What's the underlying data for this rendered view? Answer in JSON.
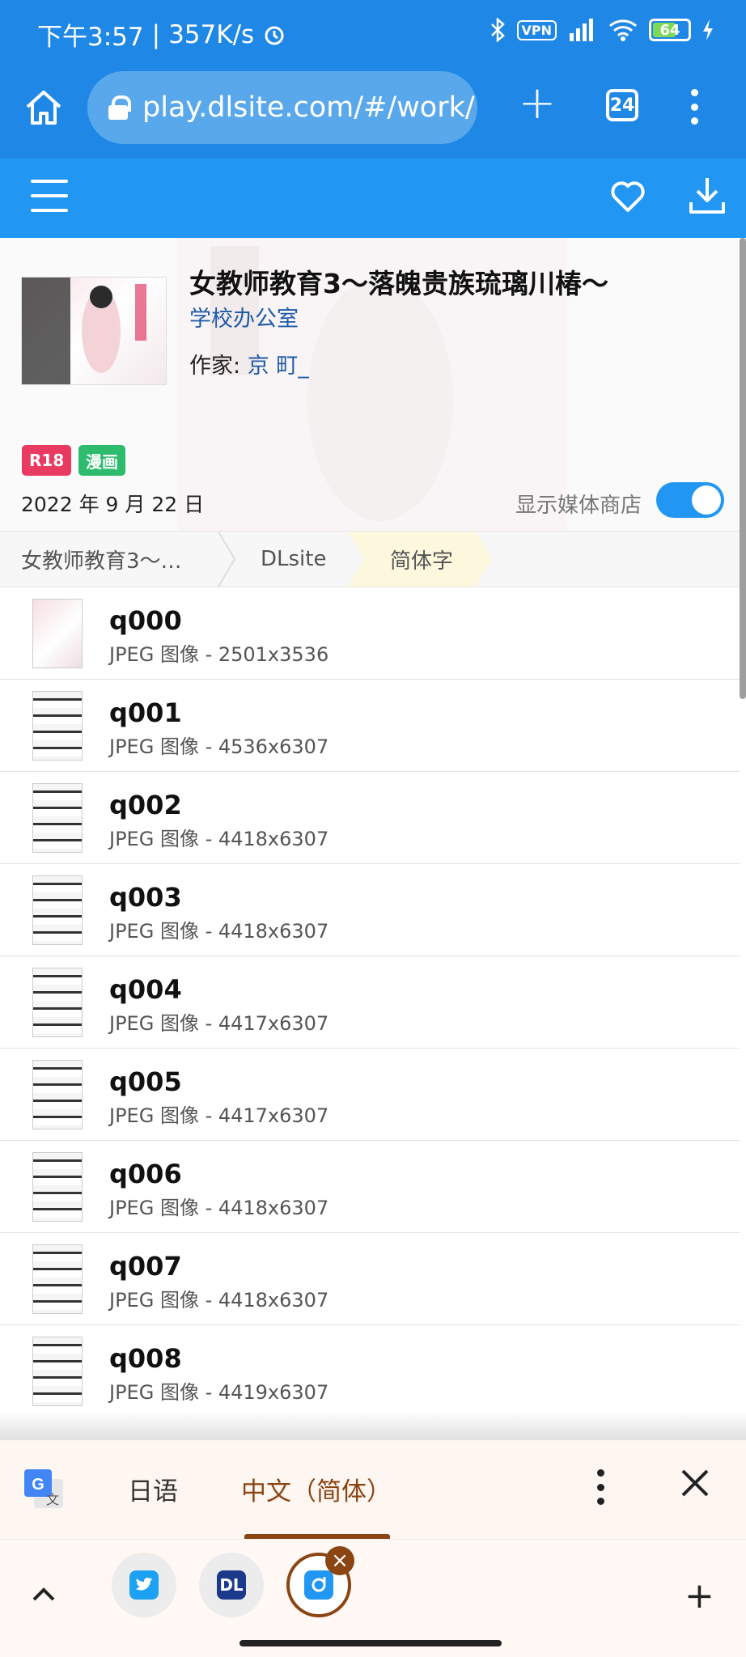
{
  "status_bar": {
    "time": "下午3:57",
    "speed": "357K/s",
    "vpn": "VPN",
    "battery": "64"
  },
  "browser": {
    "url": "play.dlsite.com/#/work/",
    "tab_count": "24"
  },
  "work": {
    "title": "女教师教育3～落魄贵族琉璃川椿～",
    "circle": "学校办公室",
    "author_label": "作家: ",
    "author": "京 町_",
    "tags": [
      "R18",
      "漫画"
    ],
    "release_date": "2022 年 9 月 22 日",
    "media_label": "显示媒体商店",
    "media_toggle": true
  },
  "breadcrumb": [
    "女教师教育3～…",
    "DLsite",
    "简体字"
  ],
  "files": [
    {
      "name": "q000",
      "desc": "JPEG 图像 - 2501x3536"
    },
    {
      "name": "q001",
      "desc": "JPEG 图像 - 4536x6307"
    },
    {
      "name": "q002",
      "desc": "JPEG 图像 - 4418x6307"
    },
    {
      "name": "q003",
      "desc": "JPEG 图像 - 4418x6307"
    },
    {
      "name": "q004",
      "desc": "JPEG 图像 - 4417x6307"
    },
    {
      "name": "q005",
      "desc": "JPEG 图像 - 4417x6307"
    },
    {
      "name": "q006",
      "desc": "JPEG 图像 - 4418x6307"
    },
    {
      "name": "q007",
      "desc": "JPEG 图像 - 4418x6307"
    },
    {
      "name": "q008",
      "desc": "JPEG 图像 - 4419x6307"
    }
  ],
  "translate": {
    "lang_source": "日语",
    "lang_target": "中文（简体）"
  },
  "dock": {
    "dl_label": "DL"
  },
  "colors": {
    "primary": "#2196f3",
    "status": "#1f87e5",
    "r18": "#e93a62",
    "manga": "#2dbb6e",
    "accent_brown": "#8b4513"
  }
}
